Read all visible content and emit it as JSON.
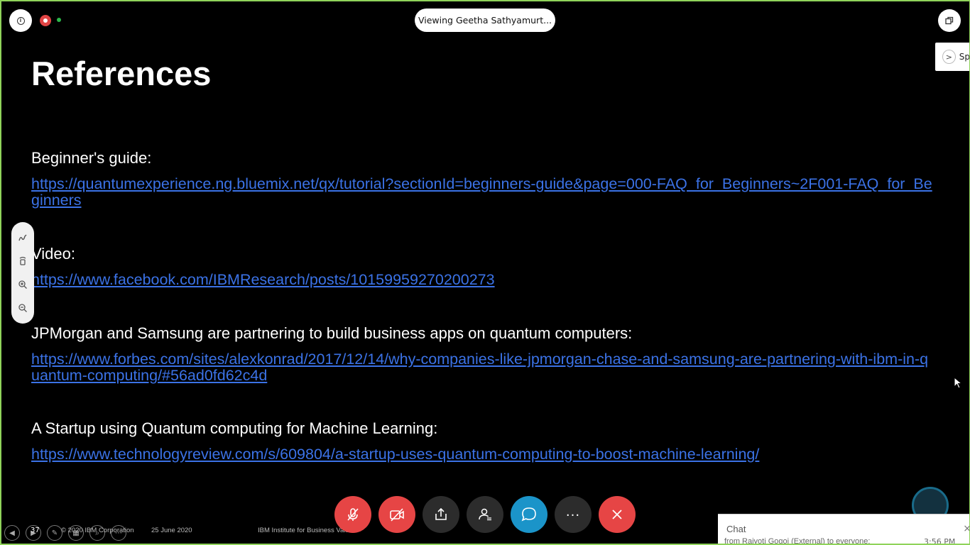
{
  "top_bar": {
    "viewing_label": "Viewing Geetha Sathyamurt..."
  },
  "side_panel_tab": {
    "label": "Sp"
  },
  "slide": {
    "title": "References",
    "references": [
      {
        "heading": "Beginner's guide:",
        "link": "https://quantumexperience.ng.bluemix.net/qx/tutorial?sectionId=beginners-guide&page=000-FAQ_for_Beginners~2F001-FAQ_for_Beginners"
      },
      {
        "heading": "Video:",
        "link": "https://www.facebook.com/IBMResearch/posts/10159959270200273"
      },
      {
        "heading": "JPMorgan and Samsung are partnering to build business apps on quantum computers:",
        "link": "https://www.forbes.com/sites/alexkonrad/2017/12/14/why-companies-like-jpmorgan-chase-and-samsung-are-partnering-with-ibm-in-quantum-computing/#56ad0fd62c4d"
      },
      {
        "heading": "A Startup using Quantum computing for Machine Learning:",
        "link": "https://www.technologyreview.com/s/609804/a-startup-uses-quantum-computing-to-boost-machine-learning/"
      }
    ],
    "page_number": "37",
    "footer_copyright": "© 2020 IBM Corporation",
    "footer_date": "25 June 2020",
    "footer_org": "IBM Institute for Business Value"
  },
  "annotation_tools": [
    "pen-icon",
    "eraser-icon",
    "zoom-in-icon",
    "zoom-out-icon"
  ],
  "controls": [
    {
      "name": "mute-button",
      "icon": "muted-microphone-icon",
      "color": "#e64545"
    },
    {
      "name": "video-button",
      "icon": "video-off-icon",
      "color": "#e64545"
    },
    {
      "name": "share-button",
      "icon": "share-icon",
      "color": "#2c2c2c"
    },
    {
      "name": "participants-button",
      "icon": "participants-icon",
      "color": "#2c2c2c"
    },
    {
      "name": "chat-button",
      "icon": "chat-icon",
      "color": "#1b94c9"
    },
    {
      "name": "more-button",
      "icon": "more-icon",
      "color": "#2c2c2c"
    },
    {
      "name": "leave-button",
      "icon": "close-icon",
      "color": "#e64545"
    }
  ],
  "chat": {
    "title": "Chat",
    "close_glyph": "×",
    "last_message_preview": "from Rajyoti Gogoi (External) to everyone:",
    "last_message_time": "3:56 PM"
  },
  "colors": {
    "link": "#3b72e6",
    "accent_red": "#e64545",
    "accent_blue": "#1b94c9",
    "frame_border": "#8fd35a"
  }
}
